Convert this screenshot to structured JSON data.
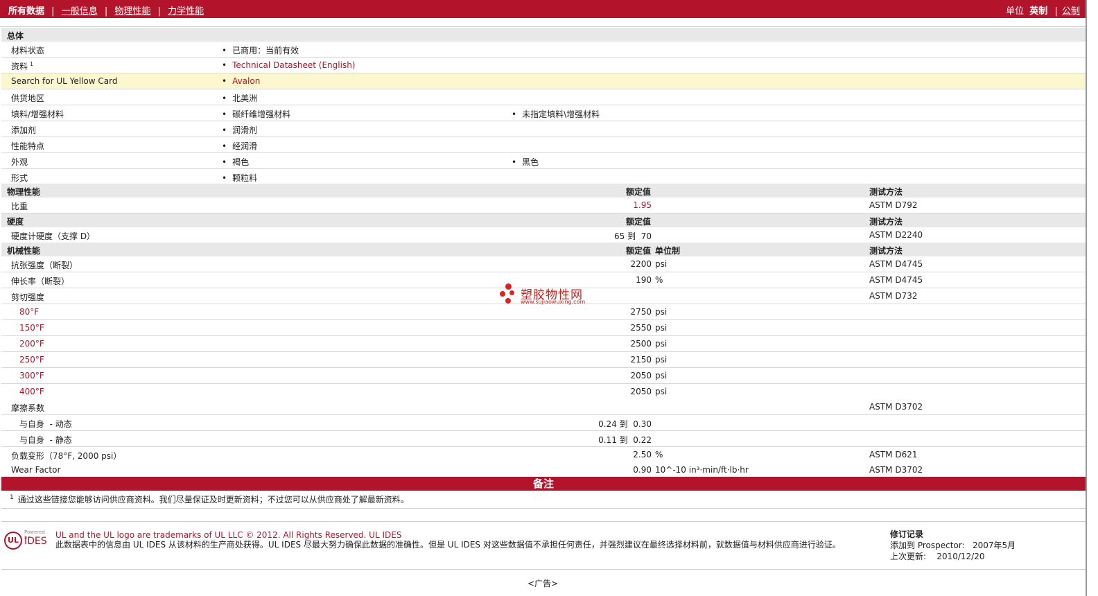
{
  "topbar": {
    "active_tab": "所有数据",
    "tabs": [
      "一般信息",
      "物理性能",
      "力学性能"
    ],
    "unit_label": "单位",
    "unit_active": "英制",
    "unit_other": "公制"
  },
  "general": {
    "section_title": "总体",
    "rows": [
      {
        "label": "材料状态",
        "values": [
          "已商用：当前有效"
        ]
      },
      {
        "label": "资料",
        "sup": "1",
        "values": [
          "Technical Datasheet (English)"
        ]
      },
      {
        "label": "Search for UL Yellow Card",
        "values": [
          "Avalon"
        ]
      },
      {
        "label": "供货地区",
        "values": [
          "北美洲"
        ]
      },
      {
        "label": "填料/增强材料",
        "values": [
          "碳纤维增强材料",
          "未指定填料\\增强材料"
        ]
      },
      {
        "label": "添加剂",
        "values": [
          "润滑剂"
        ]
      },
      {
        "label": "性能特点",
        "values": [
          "经润滑"
        ]
      },
      {
        "label": "外观",
        "values": [
          "褐色",
          "黑色"
        ]
      },
      {
        "label": "形式",
        "values": [
          "颗粒料"
        ]
      }
    ]
  },
  "physical": {
    "section_title": "物理性能",
    "value_header": "额定值",
    "method_header": "测试方法",
    "rows": [
      {
        "label": "比重",
        "value": "1.95",
        "method": "ASTM D792"
      }
    ]
  },
  "hardness": {
    "section_title": "硬度",
    "value_header": "额定值",
    "method_header": "测试方法",
    "rows": [
      {
        "label": "硬度计硬度（支撑 D）",
        "value": "65 到  70",
        "method": "ASTM D2240"
      }
    ]
  },
  "mechanical": {
    "section_title": "机械性能",
    "value_header": "额定值",
    "unit_header": "单位制",
    "method_header": "测试方法",
    "rows": [
      {
        "label": "抗张强度（断裂）",
        "value": "2200",
        "unit": "psi",
        "method": "ASTM D4745"
      },
      {
        "label": "伸长率（断裂）",
        "value": "190",
        "unit": "%",
        "method": "ASTM D4745"
      },
      {
        "label": "剪切强度",
        "value": "",
        "unit": "",
        "method": "ASTM D732"
      },
      {
        "label": "80°F",
        "sub": true,
        "value": "2750",
        "unit": "psi",
        "method": ""
      },
      {
        "label": "150°F",
        "sub": true,
        "value": "2550",
        "unit": "psi",
        "method": ""
      },
      {
        "label": "200°F",
        "sub": true,
        "value": "2500",
        "unit": "psi",
        "method": ""
      },
      {
        "label": "250°F",
        "sub": true,
        "value": "2150",
        "unit": "psi",
        "method": ""
      },
      {
        "label": "300°F",
        "sub": true,
        "value": "2050",
        "unit": "psi",
        "method": ""
      },
      {
        "label": "400°F",
        "sub": true,
        "value": "2050",
        "unit": "psi",
        "method": ""
      },
      {
        "label": "摩擦系数",
        "value": "",
        "unit": "",
        "method": "ASTM D3702"
      },
      {
        "label": "与自身  - 动态",
        "sub": true,
        "value": "0.24 到  0.30",
        "unit": "",
        "method": ""
      },
      {
        "label": "与自身  - 静态",
        "sub": true,
        "value": "0.11 到  0.22",
        "unit": "",
        "method": ""
      },
      {
        "label": "负载变形（78°F, 2000 psi）",
        "value": "2.50",
        "unit": "%",
        "method": "ASTM D621"
      },
      {
        "label": "Wear Factor",
        "value": "0.90",
        "unit": "10^-10 in³·min/ft·lb·hr",
        "method": "ASTM D3702"
      }
    ]
  },
  "notes": {
    "title": "备注",
    "footnote_sup": "1",
    "footnote": "通过这些链接您能够访问供应商资料。我们尽量保证及时更新资料；不过您可以从供应商处了解最新资料。"
  },
  "footer": {
    "logo_ul": "UL",
    "logo_powered": "Powered by",
    "logo_ides": "IDES",
    "legal_line1": "UL and the UL logo are trademarks of UL LLC © 2012. All Rights Reserved. UL IDES",
    "legal_line2": "此数据表中的信息由  UL IDES 从该材料的生产商处获得。UL IDES 尽最大努力确保此数据的准确性。但是  UL IDES 对这些数据值不承担任何责任，并强烈建议在最终选择材料前，就数据值与材料供应商进行验证。",
    "rev_title": "修订记录",
    "rev_added_label": "添加到  Prospector:",
    "rev_added_value": "2007年5月",
    "rev_updated_label": "上次更新:",
    "rev_updated_value": "2010/12/20",
    "ad": "<广告>"
  },
  "watermark": {
    "title": "塑胶物性网",
    "url": "www.sujiaowuxing.com"
  }
}
